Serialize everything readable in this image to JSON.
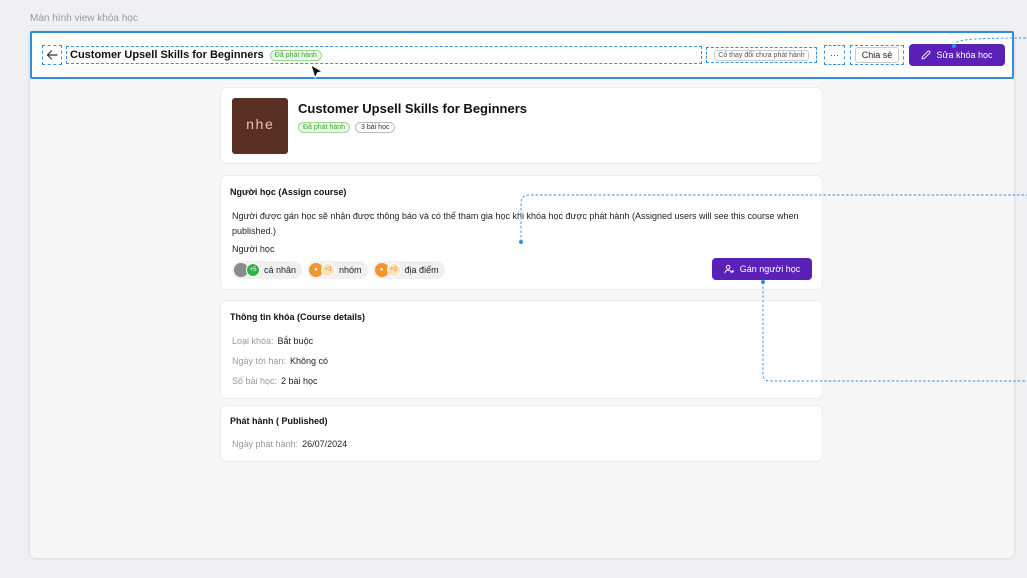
{
  "frame_label": "Màn hình view khóa học",
  "header": {
    "title": "Customer Upsell Skills for Beginners",
    "status_badge": "Đã phát hành",
    "unpublished_changes": "Có thay đổi chưa phát hành",
    "more_label": "···",
    "share_label": "Chia sẻ",
    "edit_label": "Sửa khóa học"
  },
  "course": {
    "thumb_text": "nhe",
    "title": "Customer Upsell Skills for Beginners",
    "status_badge": "Đã phát hành",
    "lessons_badge": "3 bài học"
  },
  "learners": {
    "heading": "Người học (Assign course)",
    "description": "Người được gán học sẽ nhận được thông báo và có thể tham gia học khi khóa học được phát hành (Assigned users will see this course when published.)",
    "label": "Người học",
    "chips": [
      {
        "count": "+5",
        "label": "cá nhân"
      },
      {
        "count": "+3",
        "label": "nhóm"
      },
      {
        "count": "+3",
        "label": "địa điểm"
      }
    ],
    "assign_label": "Gán người học"
  },
  "details": {
    "heading": "Thông tin khóa (Course details)",
    "rows": [
      {
        "key": "Loại khóa:",
        "value": "Bắt buộc"
      },
      {
        "key": "Ngày tới hạn:",
        "value": "Không có"
      },
      {
        "key": "Số bài học:",
        "value": "2 bài học"
      }
    ]
  },
  "published": {
    "heading": "Phát hành ( Published)",
    "rows": [
      {
        "key": "Ngày phát hành:",
        "value": "26/07/2024"
      }
    ]
  },
  "colors": {
    "accent": "#5b21b6",
    "selection": "#2e8fdf",
    "success": "#3aa83a"
  }
}
